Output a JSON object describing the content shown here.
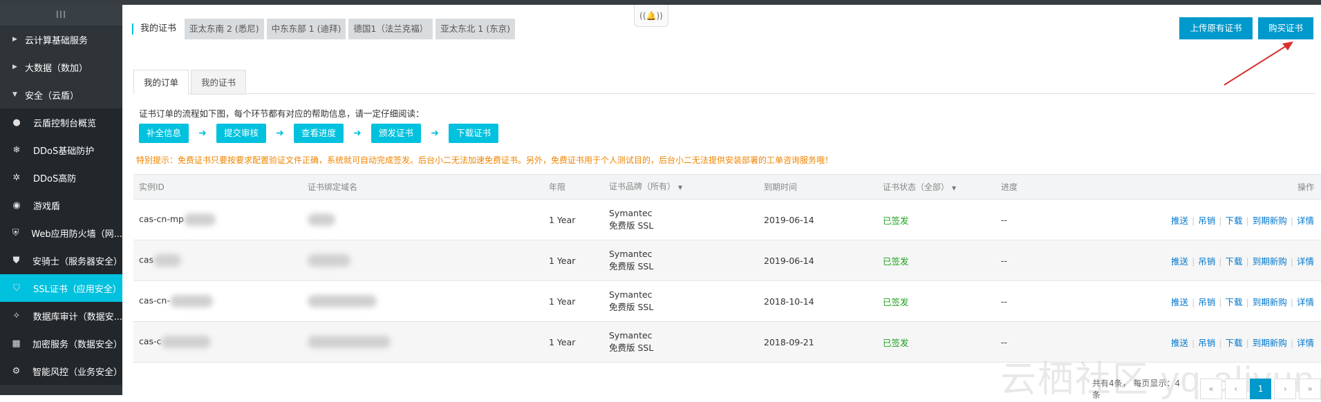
{
  "sidebar": {
    "collapse_glyph": "III",
    "groups": [
      {
        "label": "云计算基础服务",
        "expanded": false
      },
      {
        "label": "大数据（数加）",
        "expanded": false
      },
      {
        "label": "安全（云盾）",
        "expanded": true
      }
    ],
    "items": [
      {
        "label": "云盾控制台概览",
        "icon": "dot-icon"
      },
      {
        "label": "DDoS基础防护",
        "icon": "snowflake-icon"
      },
      {
        "label": "DDoS高防",
        "icon": "shield-gear-icon"
      },
      {
        "label": "游戏盾",
        "icon": "target-icon"
      },
      {
        "label": "Web应用防火墙（网...",
        "icon": "firewall-icon"
      },
      {
        "label": "安骑士（服务器安全）",
        "icon": "knight-icon"
      },
      {
        "label": "SSL证书（应用安全）",
        "icon": "certificate-icon",
        "active": true
      },
      {
        "label": "数据库审计（数据安...",
        "icon": "database-audit-icon"
      },
      {
        "label": "加密服务（数据安全）",
        "icon": "encrypt-icon"
      },
      {
        "label": "智能风控（业务安全）",
        "icon": "risk-icon"
      }
    ]
  },
  "header": {
    "title": "我的证书",
    "regions": [
      "亚太东南 2 (悉尼)",
      "中东东部 1 (迪拜)",
      "德国1（法兰克福）",
      "亚太东北 1 (东京)"
    ],
    "upload_label": "上传原有证书",
    "buy_label": "购买证书",
    "bell_text": "((🔔))"
  },
  "tabs": {
    "orders": "我的订单",
    "certs": "我的证书"
  },
  "flow": {
    "description": "证书订单的流程如下图，每个环节都有对应的帮助信息，请一定仔细阅读：",
    "steps": [
      "补全信息",
      "提交审核",
      "查看进度",
      "颁发证书",
      "下载证书"
    ],
    "arrow": "➜"
  },
  "tip": "特别提示：免费证书只要按要求配置验证文件正确，系统就可自动完成签发。后台小二无法加速免费证书。另外，免费证书用于个人测试目的，后台小二无法提供安装部署的工单咨询服务哦！",
  "table": {
    "headers": {
      "id": "实例ID",
      "domain": "证书绑定域名",
      "years": "年限",
      "brand": "证书品牌（所有）",
      "expiry": "到期时间",
      "status": "证书状态（全部）",
      "progress": "进度",
      "ops": "操作"
    },
    "sort_glyph": "▼",
    "rows": [
      {
        "id": "cas-cn-mp",
        "domain": "",
        "years": "1 Year",
        "brand": "Symantec",
        "edition": "免费版 SSL",
        "expiry": "2019-06-14",
        "status": "已签发",
        "progress": "--"
      },
      {
        "id": "cas",
        "domain": "",
        "years": "1 Year",
        "brand": "Symantec",
        "edition": "免费版 SSL",
        "expiry": "2019-06-14",
        "status": "已签发",
        "progress": "--"
      },
      {
        "id": "cas-cn-",
        "domain": "",
        "years": "1 Year",
        "brand": "Symantec",
        "edition": "免费版 SSL",
        "expiry": "2018-10-14",
        "status": "已签发",
        "progress": "--"
      },
      {
        "id": "cas-c",
        "domain": "",
        "years": "1 Year",
        "brand": "Symantec",
        "edition": "免费版 SSL",
        "expiry": "2018-09-21",
        "status": "已签发",
        "progress": "--"
      }
    ],
    "ops": [
      "推送",
      "吊销",
      "下载",
      "到期新购",
      "详情"
    ]
  },
  "pager": {
    "info": "共有4条， 每页显示：4条",
    "first": "«",
    "prev": "‹",
    "current": "1",
    "next": "›",
    "last": "»"
  },
  "watermark": "云栖社区 yq.aliyun.com",
  "colors": {
    "accent": "#00c1de",
    "primary_button": "#0099cc",
    "sidebar_bg": "#2f3438",
    "status_green": "#1ca01c",
    "tip_orange": "#f08400",
    "arrow_red": "#d9302c"
  }
}
